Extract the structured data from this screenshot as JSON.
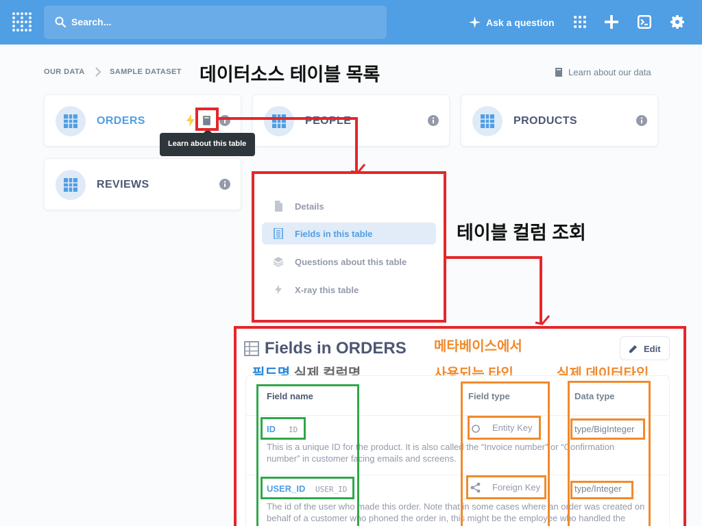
{
  "nav": {
    "search_placeholder": "Search...",
    "ask_label": "Ask a question"
  },
  "breadcrumb": {
    "root": "OUR DATA",
    "current": "SAMPLE DATASET"
  },
  "annotations": {
    "table_list_title": "데이터소스 테이블 목록",
    "column_lookup": "테이블 컬럼 조회",
    "metabase_type_line1": "메타베이스에서",
    "metabase_type_line2": "사용되는 타입",
    "actual_data_type": "실제 데이터타입",
    "field_name_label": "필드명",
    "actual_column_label": "실제 컬럼명"
  },
  "learn_about_data": "Learn about our data",
  "tables": [
    {
      "name": "ORDERS"
    },
    {
      "name": "PEOPLE"
    },
    {
      "name": "PRODUCTS"
    },
    {
      "name": "REVIEWS"
    }
  ],
  "tooltip": "Learn about this table",
  "menu": [
    {
      "label": "Details",
      "icon": "document-icon"
    },
    {
      "label": "Fields in this table",
      "icon": "list-icon"
    },
    {
      "label": "Questions about this table",
      "icon": "layers-icon"
    },
    {
      "label": "X-ray this table",
      "icon": "bolt-icon"
    }
  ],
  "fields_panel": {
    "title": "Fields in ORDERS",
    "edit_label": "Edit",
    "headers": {
      "field_name": "Field name",
      "field_type": "Field type",
      "data_type": "Data type"
    },
    "rows": [
      {
        "display_name": "ID",
        "db_name": "ID",
        "description_1": "This is a unique ID for the product. It is also called the “Invoice number” or “Confirmation",
        "description_2": "number” in customer facing emails and screens.",
        "field_type": "Entity Key",
        "data_type": "type/BigInteger"
      },
      {
        "display_name": "USER_ID",
        "db_name": "USER_ID",
        "description_1": "The id of the user who made this order. Note that in some cases where an order was created on",
        "description_2": "behalf of a customer who phoned the order in, this might be the employee who handled the",
        "field_type": "Foreign Key",
        "data_type": "type/Integer"
      }
    ]
  },
  "colors": {
    "brand": "#509ee3",
    "annotation_red": "#e5262a",
    "annotation_green": "#2ea84a",
    "annotation_orange": "#f08a2c"
  }
}
